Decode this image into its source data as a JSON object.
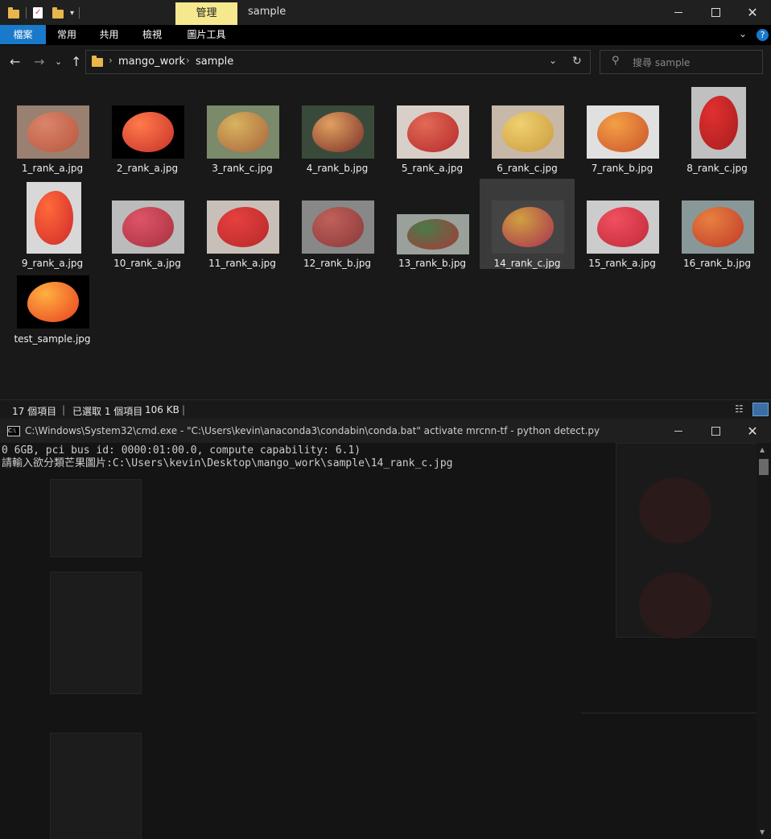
{
  "explorer": {
    "window_title": "sample",
    "manage_tab": "管理",
    "ribbon_tabs": [
      "檔案",
      "常用",
      "共用",
      "檢視",
      "圖片工具"
    ],
    "breadcrumb": [
      "mango_work",
      "sample"
    ],
    "search_placeholder": "搜尋 sample",
    "files": [
      {
        "name": "1_rank_a.jpg",
        "selected": false
      },
      {
        "name": "2_rank_a.jpg",
        "selected": false
      },
      {
        "name": "3_rank_c.jpg",
        "selected": false
      },
      {
        "name": "4_rank_b.jpg",
        "selected": false
      },
      {
        "name": "5_rank_a.jpg",
        "selected": false
      },
      {
        "name": "6_rank_c.jpg",
        "selected": false
      },
      {
        "name": "7_rank_b.jpg",
        "selected": false
      },
      {
        "name": "8_rank_c.jpg",
        "selected": false
      },
      {
        "name": "9_rank_a.jpg",
        "selected": false
      },
      {
        "name": "10_rank_a.jpg",
        "selected": false
      },
      {
        "name": "11_rank_a.jpg",
        "selected": false
      },
      {
        "name": "12_rank_b.jpg",
        "selected": false
      },
      {
        "name": "13_rank_b.jpg",
        "selected": false
      },
      {
        "name": "14_rank_c.jpg",
        "selected": true
      },
      {
        "name": "15_rank_a.jpg",
        "selected": false
      },
      {
        "name": "16_rank_b.jpg",
        "selected": false
      },
      {
        "name": "test_sample.jpg",
        "selected": false
      }
    ],
    "status": {
      "item_count": "17 個項目",
      "selected": "已選取 1 個項目",
      "size": "106 KB"
    }
  },
  "cmd": {
    "title": "C:\\Windows\\System32\\cmd.exe - \"C:\\Users\\kevin\\anaconda3\\condabin\\conda.bat\"  activate mrcnn-tf - python  detect.py",
    "line1": "0 6GB, pci bus id: 0000:01:00.0, compute capability: 6.1)",
    "line2": "請輸入欲分類芒果圖片:C:\\Users\\kevin\\Desktop\\mango_work\\sample\\14_rank_c.jpg"
  },
  "colors": {
    "file_tab": "#1979ca",
    "manage_tab": "#f5e88f",
    "folder": "#e8b64a"
  }
}
